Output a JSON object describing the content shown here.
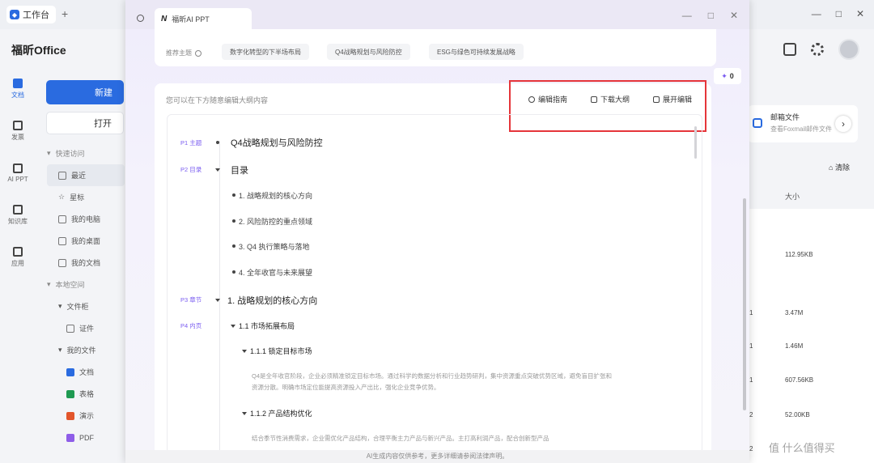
{
  "bg": {
    "tab_title": "工作台",
    "tab_plus": "+",
    "brand": "福昕Office",
    "rail": [
      {
        "label": "文档",
        "active": true
      },
      {
        "label": "发票",
        "active": false
      },
      {
        "label": "AI PPT",
        "active": false
      },
      {
        "label": "知识库",
        "active": false
      },
      {
        "label": "应用",
        "active": false
      }
    ],
    "new_label": "新建",
    "open_label": "打开",
    "nav": [
      {
        "label": "快速访问",
        "kind": "sec"
      },
      {
        "label": "最近",
        "kind": "l1",
        "selected": true
      },
      {
        "label": "星标",
        "kind": "l1"
      },
      {
        "label": "我的电脑",
        "kind": "l1"
      },
      {
        "label": "我的桌面",
        "kind": "l1"
      },
      {
        "label": "我的文档",
        "kind": "l1"
      },
      {
        "label": "本地空间",
        "kind": "sec"
      },
      {
        "label": "文件柜",
        "kind": "l1"
      },
      {
        "label": "证件",
        "kind": "l2"
      },
      {
        "label": "我的文件",
        "kind": "l1"
      },
      {
        "label": "文档",
        "kind": "l2",
        "icon": "w"
      },
      {
        "label": "表格",
        "kind": "l2",
        "icon": "x"
      },
      {
        "label": "演示",
        "kind": "l2",
        "icon": "p"
      },
      {
        "label": "PDF",
        "kind": "l2",
        "icon": "f"
      }
    ],
    "card_title": "邮箱文件",
    "card_sub": "查看Foxmail邮件文件",
    "clear_label": "清除",
    "size_header": "大小",
    "files": [
      {
        "idx": "",
        "size": "112.95KB"
      },
      {
        "idx": "1",
        "size": "3.47M"
      },
      {
        "idx": "1",
        "size": "1.46M"
      },
      {
        "idx": "1",
        "size": "607.56KB"
      },
      {
        "idx": "2",
        "size": "52.00KB"
      },
      {
        "idx": "2",
        "size": ""
      }
    ],
    "watermark": "值 什么值得买"
  },
  "win": {
    "tab_logo": "N",
    "tab_title": "福昕AI PPT",
    "ctl_min": "—",
    "ctl_max": "□",
    "ctl_close": "✕",
    "topics_label": "推荐主题",
    "topics": [
      "数字化转型的下半场布局",
      "Q4战略规划与风险防控",
      "ESG与绿色可持续发展战略"
    ],
    "badge": "0",
    "hint": "您可以在下方随意编辑大纲内容",
    "actions": [
      "编辑指南",
      "下载大纲",
      "展开编辑"
    ],
    "outline": [
      {
        "page": "P1 主题",
        "text": "Q4战略规划与风险防控"
      },
      {
        "page": "P2 目录",
        "text": "目录"
      },
      {
        "page": "",
        "text": "1.  战略规划的核心方向"
      },
      {
        "page": "",
        "text": "2.  风险防控的重点领域"
      },
      {
        "page": "",
        "text": "3.  Q4 执行策略与落地"
      },
      {
        "page": "",
        "text": "4.  全年收官与未来展望"
      },
      {
        "page": "P3 章节",
        "text": "1.  战略规划的核心方向"
      },
      {
        "page": "P4 内页",
        "text": "1.1  市场拓展布局"
      },
      {
        "page": "",
        "text": "1.1.1  锁定目标市场"
      },
      {
        "page": "",
        "text": "Q4是全年收官阶段，企业必须精准锁定目标市场。通过科学的数据分析和行业趋势研判，集中资源重点突破优势区域，避免盲目扩张和资源分散。明确市场定位能提高资源投入产出比，强化企业竞争优势。"
      },
      {
        "page": "",
        "text": "1.1.2  产品结构优化"
      },
      {
        "page": "",
        "text": "结合季节性消费需求，企业需优化产品结构，合理平衡主力产品与新兴产品。主打高利润产品，配合创新型产品"
      }
    ],
    "footer": "AI生成内容仅供参考，更多详细请参阅法律声明。"
  }
}
